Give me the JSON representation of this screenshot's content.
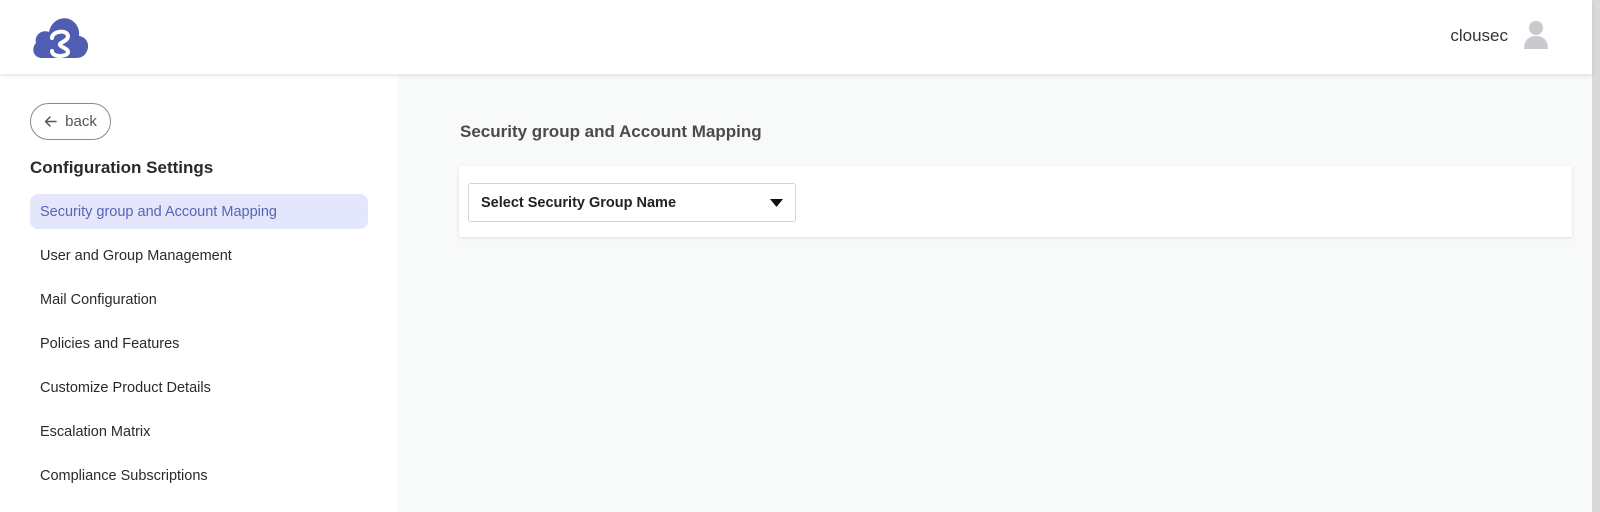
{
  "header": {
    "username": "clousec",
    "logo_icon": "cloud-link-logo",
    "avatar_icon": "user-avatar-icon"
  },
  "sidebar": {
    "back_label": "back",
    "title": "Configuration Settings",
    "items": [
      {
        "label": "Security group and Account Mapping",
        "active": true
      },
      {
        "label": "User and Group Management",
        "active": false
      },
      {
        "label": "Mail Configuration",
        "active": false
      },
      {
        "label": "Policies and Features",
        "active": false
      },
      {
        "label": "Customize Product Details",
        "active": false
      },
      {
        "label": "Escalation Matrix",
        "active": false
      },
      {
        "label": "Compliance Subscriptions",
        "active": false
      }
    ]
  },
  "main": {
    "title": "Security group and Account Mapping",
    "select": {
      "value": "Select Security Group Name"
    }
  },
  "colors": {
    "accent": "#5763b5",
    "active_bg": "#e4e7fb",
    "logo": "#4f5db3",
    "main_bg": "#f8f9f9"
  }
}
